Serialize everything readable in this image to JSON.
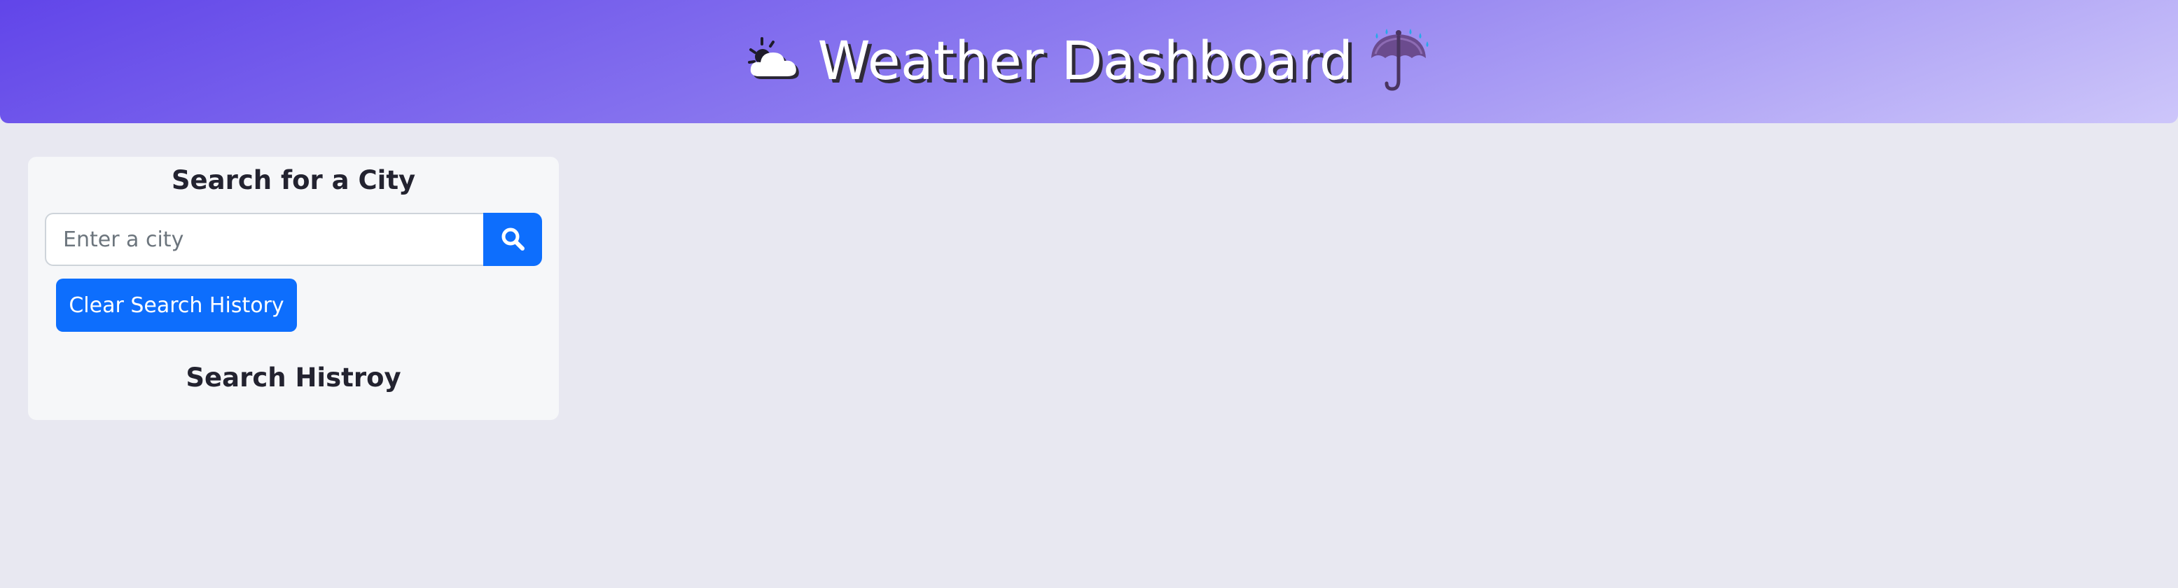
{
  "header": {
    "title": "Weather Dashboard",
    "left_icon": "sun-behind-cloud-icon",
    "right_icon": "umbrella-with-rain-icon"
  },
  "search": {
    "heading": "Search for a City",
    "placeholder": "Enter a city",
    "value": "",
    "search_icon": "search-icon",
    "clear_label": "Clear Search History",
    "history_heading": "Search Histroy",
    "history_items": []
  },
  "colors": {
    "header_gradient_start": "#6145e9",
    "header_gradient_end": "#cdc6fa",
    "page_background": "#e8e8f1",
    "card_background": "#f6f7f9",
    "button_primary": "#0d6efd"
  }
}
